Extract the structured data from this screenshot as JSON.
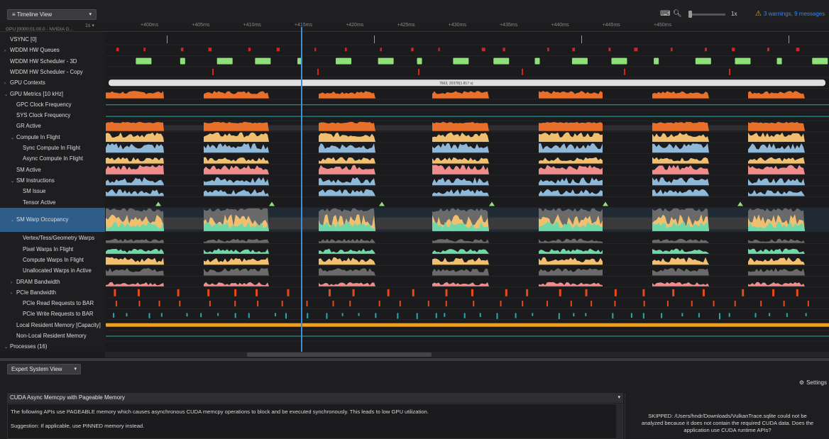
{
  "toolbar": {
    "view_label": "≡ Timeline View",
    "zoom_level": "1x",
    "warnings": "3 warnings, 9 messages"
  },
  "ruler": {
    "left_label": "1s ▾",
    "ticks": [
      "+400ms",
      "+405ms",
      "+410ms",
      "+415ms",
      "+420ms",
      "+425ms",
      "+430ms",
      "+435ms",
      "+440ms",
      "+445ms",
      "+450ms"
    ],
    "gpu_header": "GPU [0000:01:00.0 - NVIDIA G..."
  },
  "rows": [
    {
      "label": "VSYNC [0]",
      "indent": 0,
      "exp": ""
    },
    {
      "label": "WDDM HW Queues",
      "indent": 0,
      "exp": "›"
    },
    {
      "label": "WDDM HW Scheduler - 3D",
      "indent": 0,
      "exp": ""
    },
    {
      "label": "WDDM HW Scheduler - Copy",
      "indent": 0,
      "exp": ""
    },
    {
      "label": "GPU Contexts",
      "indent": 0,
      "exp": "›"
    },
    {
      "label": "GPU Metrics [10 kHz]",
      "indent": 0,
      "exp": "⌄"
    },
    {
      "label": "GPC Clock Frequency",
      "indent": 1,
      "exp": ""
    },
    {
      "label": "SYS Clock Frequency",
      "indent": 1,
      "exp": ""
    },
    {
      "label": "GR Active",
      "indent": 1,
      "exp": ""
    },
    {
      "label": "Compute In Flight",
      "indent": 1,
      "exp": "⌄"
    },
    {
      "label": "Sync Compute In Flight",
      "indent": 2,
      "exp": ""
    },
    {
      "label": "Async Compute In Flight",
      "indent": 2,
      "exp": ""
    },
    {
      "label": "SM Active",
      "indent": 1,
      "exp": ""
    },
    {
      "label": "SM Instructions",
      "indent": 1,
      "exp": "⌄"
    },
    {
      "label": "SM Issue",
      "indent": 2,
      "exp": ""
    },
    {
      "label": "Tensor Active",
      "indent": 2,
      "exp": ""
    },
    {
      "label": "SM Warp Occupancy",
      "indent": 1,
      "exp": "⌄",
      "selected": true
    },
    {
      "label": "Vertex/Tess/Geometry Warps",
      "indent": 2,
      "exp": ""
    },
    {
      "label": "Pixel Warps In Flight",
      "indent": 2,
      "exp": ""
    },
    {
      "label": "Compute Warps In Flight",
      "indent": 2,
      "exp": ""
    },
    {
      "label": "Unallocated Warps in Active",
      "indent": 2,
      "exp": ""
    },
    {
      "label": "DRAM Bandwidth",
      "indent": 1,
      "exp": "›"
    },
    {
      "label": "PCIe Bandwidth",
      "indent": 1,
      "exp": "›"
    },
    {
      "label": "PCIe Read Requests to BAR",
      "indent": 2,
      "exp": ""
    },
    {
      "label": "PCIe Write Requests to BAR",
      "indent": 2,
      "exp": ""
    },
    {
      "label": "Local Resident Memory [Capacity]",
      "indent": 1,
      "exp": ""
    },
    {
      "label": "Non-Local Resident Memory",
      "indent": 1,
      "exp": ""
    },
    {
      "label": "Processes (16)",
      "indent": 0,
      "exp": "⌄"
    }
  ],
  "context_bar_label": "7663, 20378(1.817 s)",
  "colors": {
    "orange": "#e8702a",
    "blue": "#8fb8d8",
    "yellow": "#f0c070",
    "pink": "#f08c8c",
    "green": "#6fd8a8",
    "gray": "#6a6a6a",
    "accent": "#3a8fd8",
    "gold": "#f0a020",
    "boxgreen": "#8fe07a",
    "red": "#e02020",
    "teal": "#2aa8a8"
  },
  "bottom": {
    "view_label": "Expert System View",
    "settings_label": "Settings",
    "rule_title": "CUDA Async Memcpy with Pageable Memory",
    "rule_line1": "The following APIs use PAGEABLE memory which causes asynchronous CUDA memcpy operations to block and be executed synchronously. This leads to low GPU utilization.",
    "rule_line2": "Suggestion: If applicable, use PINNED memory instead.",
    "skipped_lines": [
      "SKIPPED: /Users/hndr/Downloads/VulkanTrace.sqlite could not be",
      "analyzed because it does not contain the required CUDA data. Does the",
      "application use CUDA runtime APIs?"
    ]
  }
}
